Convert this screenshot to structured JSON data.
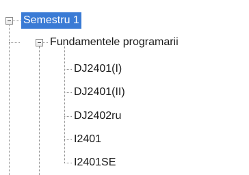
{
  "tree": {
    "root": {
      "label": "Semestru 1",
      "selected": true,
      "expanded": true,
      "children": [
        {
          "label": "Fundamentele programarii",
          "expanded": true,
          "children": [
            {
              "label": "DJ2401(I)"
            },
            {
              "label": "DJ2401(II)"
            },
            {
              "label": "DJ2402ru"
            },
            {
              "label": "I2401"
            },
            {
              "label": "I2401SE"
            }
          ]
        }
      ]
    },
    "colors": {
      "selection_background": "#3a7bd5",
      "selection_text": "#ffffff",
      "connector_lines": "#8a8a8a",
      "text": "#1a1a1a"
    },
    "icons": {
      "expanded_toggle": "minus-box-icon"
    }
  }
}
